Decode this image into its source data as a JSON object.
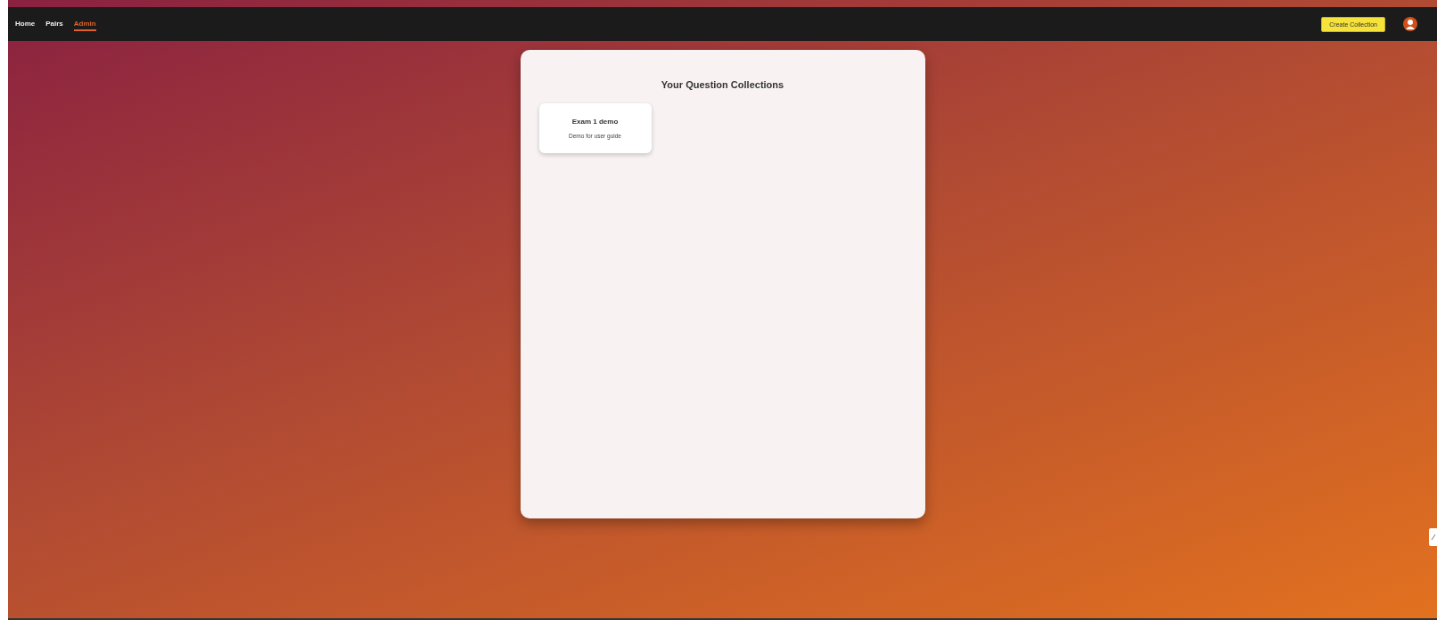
{
  "nav": {
    "items": [
      {
        "label": "Home",
        "selected": false
      },
      {
        "label": "Pairs",
        "selected": false
      },
      {
        "label": "Admin",
        "selected": true
      }
    ],
    "create_button": "Create Collection"
  },
  "panel": {
    "title": "Your Question Collections",
    "collections": [
      {
        "title": "Exam 1 demo",
        "description": "Demo for user guide"
      }
    ]
  }
}
